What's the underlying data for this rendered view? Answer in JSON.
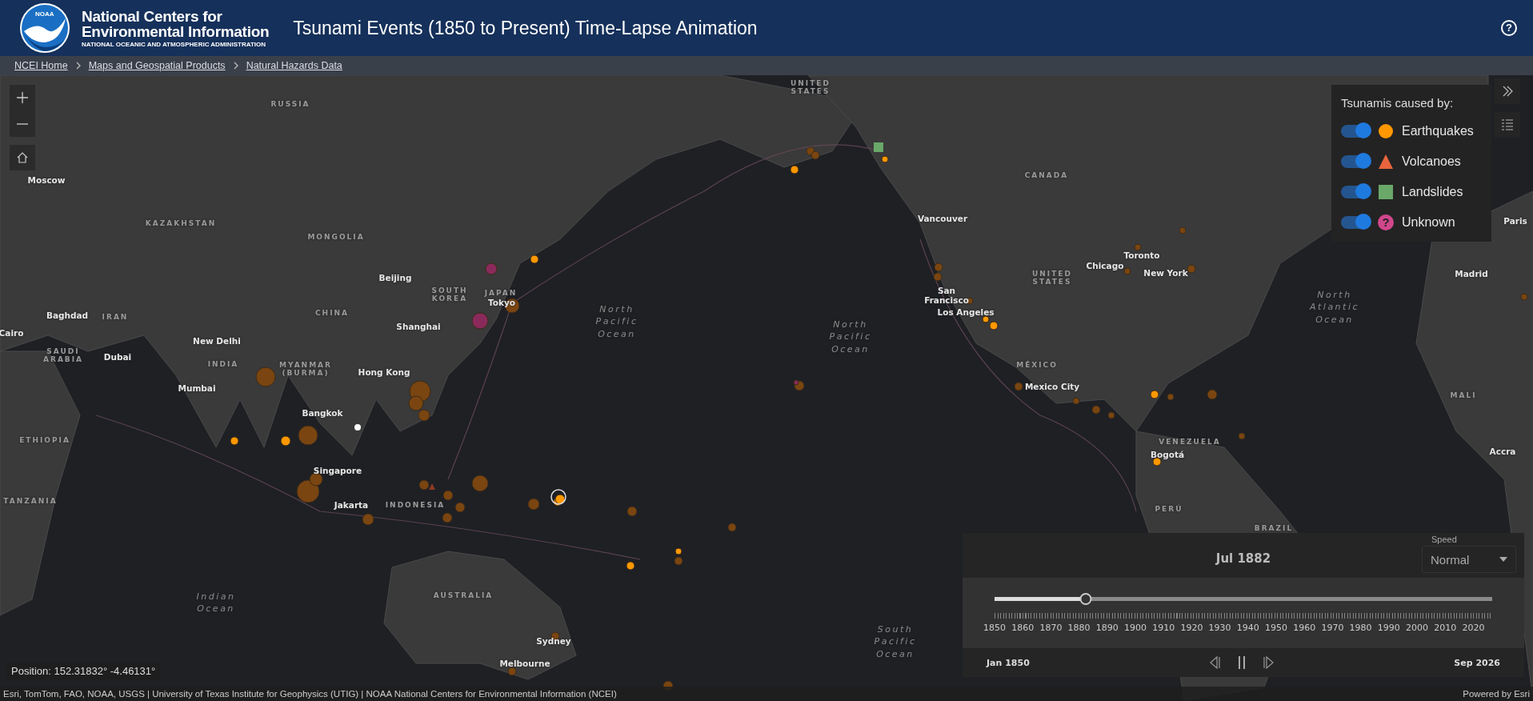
{
  "header": {
    "logo_text": "NOAA",
    "org_line_1": "National Centers for",
    "org_line_2": "Environmental Information",
    "org_line_3": "NATIONAL OCEANIC AND ATMOSPHERIC ADMINISTRATION",
    "title": "Tsunami Events (1850 to Present) Time-Lapse Animation",
    "help_glyph": "?"
  },
  "breadcrumbs": [
    {
      "label": "NCEI Home"
    },
    {
      "label": "Maps and Geospatial Products"
    },
    {
      "label": "Natural Hazards Data"
    }
  ],
  "map_labels": [
    {
      "text": "RUSSIA",
      "kind": "country"
    },
    {
      "text": "UNITED STATES",
      "kind": "country"
    },
    {
      "text": "Moscow",
      "kind": "city"
    },
    {
      "text": "KAZAKHSTAN",
      "kind": "country"
    },
    {
      "text": "MONGOLIA",
      "kind": "country"
    },
    {
      "text": "CANADA",
      "kind": "country"
    },
    {
      "text": "Vancouver",
      "kind": "city"
    },
    {
      "text": "Beijing",
      "kind": "city"
    },
    {
      "text": "SOUTH KOREA",
      "kind": "country"
    },
    {
      "text": "JAPAN",
      "kind": "country"
    },
    {
      "text": "Tokyo",
      "kind": "city"
    },
    {
      "text": "CHINA",
      "kind": "country"
    },
    {
      "text": "Baghdad",
      "kind": "city"
    },
    {
      "text": "IRAN",
      "kind": "country"
    },
    {
      "text": "Cairo",
      "kind": "city"
    },
    {
      "text": "Shanghai",
      "kind": "city"
    },
    {
      "text": "New Delhi",
      "kind": "city"
    },
    {
      "text": "INDIA",
      "kind": "country"
    },
    {
      "text": "SAUDI ARABIA",
      "kind": "country"
    },
    {
      "text": "Dubai",
      "kind": "city"
    },
    {
      "text": "MYANMAR (BURMA)",
      "kind": "country"
    },
    {
      "text": "Hong Kong",
      "kind": "city"
    },
    {
      "text": "Mumbai",
      "kind": "city"
    },
    {
      "text": "Bangkok",
      "kind": "city"
    },
    {
      "text": "ETHIOPIA",
      "kind": "country"
    },
    {
      "text": "Singapore",
      "kind": "city"
    },
    {
      "text": "Jakarta",
      "kind": "city"
    },
    {
      "text": "INDONESIA",
      "kind": "country"
    },
    {
      "text": "TANZANIA",
      "kind": "country"
    },
    {
      "text": "Indian Ocean",
      "kind": "ocean"
    },
    {
      "text": "AUSTRALIA",
      "kind": "country"
    },
    {
      "text": "Sydney",
      "kind": "city"
    },
    {
      "text": "Melbourne",
      "kind": "city"
    },
    {
      "text": "North Pacific Ocean",
      "kind": "ocean"
    },
    {
      "text": "North Pacific Ocean",
      "kind": "ocean"
    },
    {
      "text": "San Francisco",
      "kind": "city"
    },
    {
      "text": "Los Angeles",
      "kind": "city"
    },
    {
      "text": "UNITED STATES",
      "kind": "country"
    },
    {
      "text": "Chicago",
      "kind": "city"
    },
    {
      "text": "Toronto",
      "kind": "city"
    },
    {
      "text": "New York",
      "kind": "city"
    },
    {
      "text": "North Atlantic Ocean",
      "kind": "ocean"
    },
    {
      "text": "Paris",
      "kind": "city"
    },
    {
      "text": "Madrid",
      "kind": "city"
    },
    {
      "text": "MÉXICO",
      "kind": "country"
    },
    {
      "text": "Mexico City",
      "kind": "city"
    },
    {
      "text": "MALI",
      "kind": "country"
    },
    {
      "text": "VENEZUELA",
      "kind": "country"
    },
    {
      "text": "Bogotá",
      "kind": "city"
    },
    {
      "text": "Accra",
      "kind": "city"
    },
    {
      "text": "PERÚ",
      "kind": "country"
    },
    {
      "text": "BRAZIL",
      "kind": "country"
    },
    {
      "text": "South Pacific Ocean",
      "kind": "ocean"
    }
  ],
  "legend": {
    "title": "Tsunamis caused by:",
    "items": [
      {
        "label": "Earthquakes",
        "on": true,
        "kind": "circle",
        "color": "#ff9800"
      },
      {
        "label": "Volcanoes",
        "on": true,
        "kind": "triangle",
        "color": "#e8643c"
      },
      {
        "label": "Landslides",
        "on": true,
        "kind": "square",
        "color": "#6aa86a"
      },
      {
        "label": "Unknown",
        "on": true,
        "kind": "question",
        "color": "#d0478c",
        "symbol": "?"
      }
    ]
  },
  "time_slider": {
    "current": "Jul 1882",
    "level": 0.184,
    "ticks": [
      "1850",
      "1860",
      "1870",
      "1880",
      "1890",
      "1900",
      "1910",
      "1920",
      "1930",
      "1940",
      "1950",
      "1960",
      "1970",
      "1980",
      "1990",
      "2000",
      "2010",
      "2020"
    ],
    "start": "Jan 1850",
    "end": "Sep 2026",
    "playing": true,
    "speed": {
      "label": "Speed",
      "value": "Normal"
    }
  },
  "position": "Position: 152.31832° -4.46131°",
  "attribution": "Esri, TomTom, FAO, NOAA, USGS | University of Texas Institute for Geophysics (UTIG) | NOAA National Centers for Environmental Information (NCEI)",
  "powered_by": "Powered by Esri"
}
